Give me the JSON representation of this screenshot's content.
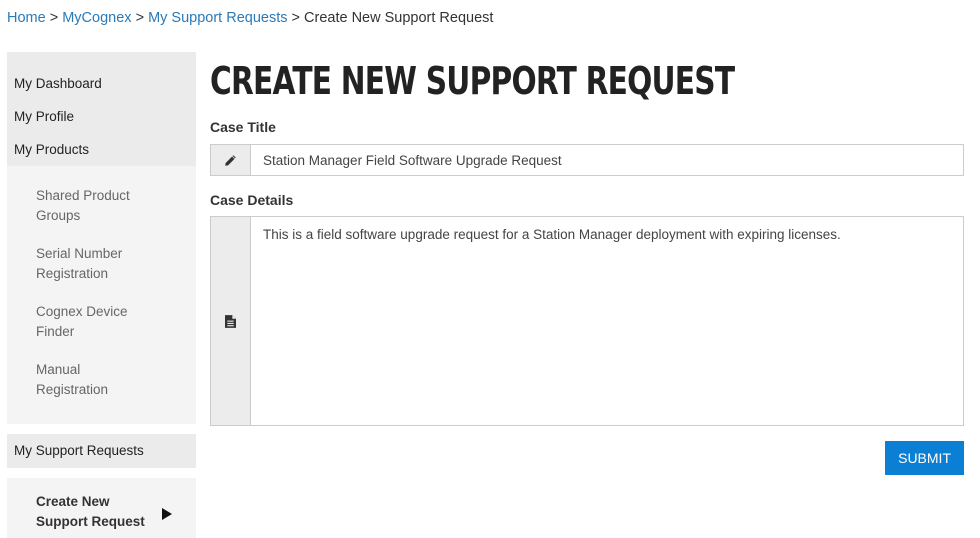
{
  "breadcrumb": {
    "items": [
      "Home",
      "MyCognex",
      "My Support Requests"
    ],
    "separator": ">",
    "current": "Create New Support Request"
  },
  "sidebar": {
    "top_items": [
      "My Dashboard",
      "My Profile",
      "My Products"
    ],
    "sub_items": [
      "Shared Product Groups",
      "Serial Number Registration",
      "Cognex Device Finder",
      "Manual Registration"
    ],
    "support_requests": "My Support Requests",
    "current": "Create New Support Request"
  },
  "main": {
    "title": "CREATE NEW SUPPORT REQUEST",
    "case_title_label": "Case Title",
    "case_title_value": "Station Manager Field Software Upgrade Request",
    "case_details_label": "Case Details",
    "case_details_value": "This is a field software upgrade request for a Station Manager deployment with expiring licenses.",
    "submit_label": "SUBMIT"
  },
  "icons": {
    "case_title": "pencil-icon",
    "case_details": "document-icon"
  },
  "colors": {
    "link": "#2a7ab8",
    "accent": "#0b7fd4"
  }
}
